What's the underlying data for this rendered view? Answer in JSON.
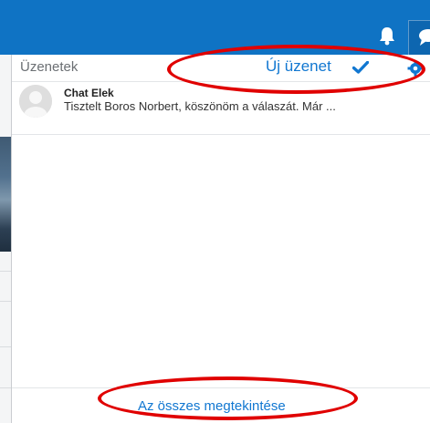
{
  "header": {
    "title": "Üzenetek",
    "new_message_label": "Új üzenet"
  },
  "messages": [
    {
      "sender": "Chat Elek",
      "preview": "Tisztelt Boros Norbert, köszönöm a válaszát. Már ..."
    }
  ],
  "footer": {
    "view_all_label": "Az összes megtekintése"
  },
  "icons": {
    "notifications": "bell-icon",
    "messages": "speech-bubble-icon",
    "mark_all_read": "checkmark-icon",
    "settings": "gear-icon",
    "avatar": "user-avatar-icon"
  },
  "colors": {
    "navbar": "#0f73c4",
    "link": "#1177d1",
    "annotation": "#e00000"
  }
}
